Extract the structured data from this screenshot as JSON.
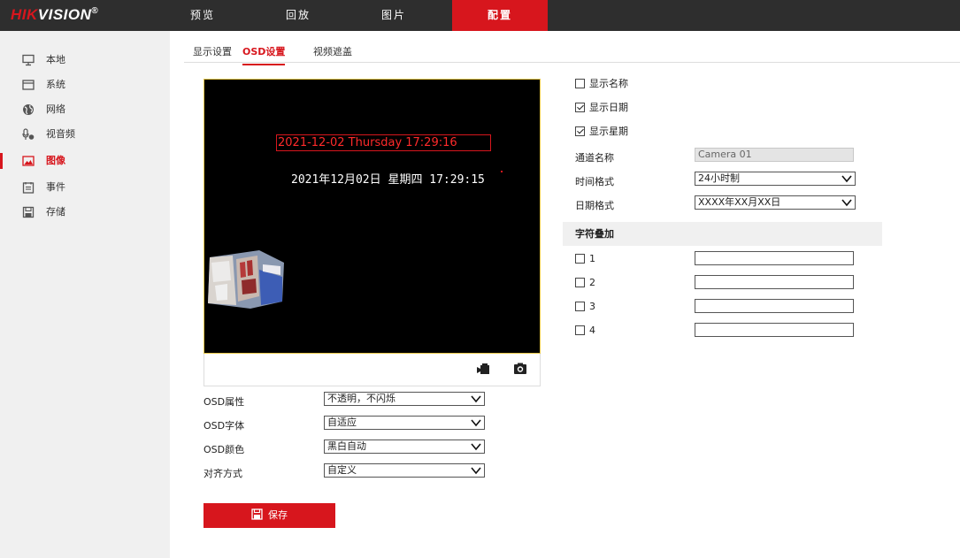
{
  "logo": {
    "brand_red": "HIK",
    "brand_white": "VISION",
    "reg": "®"
  },
  "nav": {
    "tabs": [
      {
        "label": "预览"
      },
      {
        "label": "回放"
      },
      {
        "label": "图片"
      },
      {
        "label": "配置",
        "active": true
      }
    ]
  },
  "sidebar": {
    "items": [
      {
        "label": "本地",
        "icon": "monitor-icon"
      },
      {
        "label": "系统",
        "icon": "system-icon"
      },
      {
        "label": "网络",
        "icon": "globe-icon"
      },
      {
        "label": "视音频",
        "icon": "microphone-icon"
      },
      {
        "label": "图像",
        "icon": "image-icon",
        "active": true
      },
      {
        "label": "事件",
        "icon": "calendar-icon"
      },
      {
        "label": "存储",
        "icon": "storage-icon"
      }
    ]
  },
  "subtabs": [
    {
      "label": "显示设置"
    },
    {
      "label": "OSD设置",
      "active": true
    },
    {
      "label": "视频遮盖"
    }
  ],
  "preview": {
    "osd_date_en": "2021-12-02 Thursday 17:29:16",
    "osd_date_cn": "2021年12月02日  星期四  17:29:15"
  },
  "osd_form": {
    "attribute": {
      "label": "OSD属性",
      "value": "不透明，不闪烁"
    },
    "font": {
      "label": "OSD字体",
      "value": "自适应"
    },
    "color": {
      "label": "OSD颜色",
      "value": "黑白自动"
    },
    "align": {
      "label": "对齐方式",
      "value": "自定义"
    }
  },
  "save_label": "保存",
  "display": {
    "show_name": {
      "label": "显示名称",
      "checked": false
    },
    "show_date": {
      "label": "显示日期",
      "checked": true
    },
    "show_week": {
      "label": "显示星期",
      "checked": true
    },
    "channel_name": {
      "label": "通道名称",
      "value": "Camera 01"
    },
    "time_format": {
      "label": "时间格式",
      "value": "24小时制"
    },
    "date_format": {
      "label": "日期格式",
      "value": "XXXX年XX月XX日"
    }
  },
  "text_overlay": {
    "title": "字符叠加",
    "rows": [
      {
        "label": "1",
        "checked": false,
        "value": ""
      },
      {
        "label": "2",
        "checked": false,
        "value": ""
      },
      {
        "label": "3",
        "checked": false,
        "value": ""
      },
      {
        "label": "4",
        "checked": false,
        "value": ""
      }
    ]
  },
  "colors": {
    "accent": "#d7161d",
    "topbar": "#2e2e2e",
    "sidebar": "#f0f0f0"
  }
}
